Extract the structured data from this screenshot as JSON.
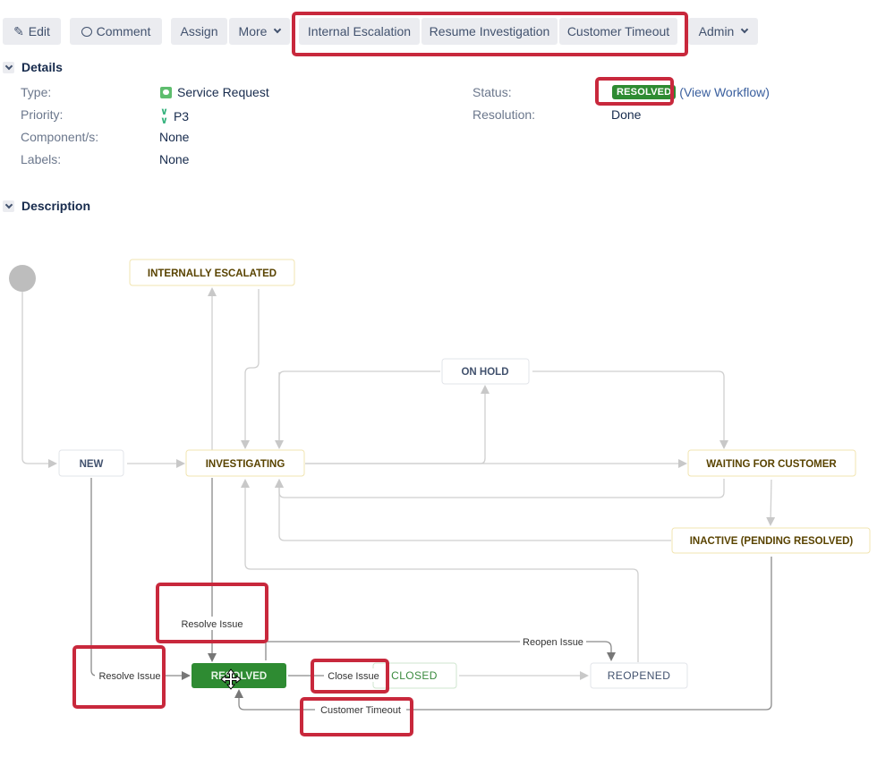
{
  "toolbar": {
    "edit": "Edit",
    "comment": "Comment",
    "assign": "Assign",
    "more": "More",
    "transitions": [
      "Internal Escalation",
      "Resume Investigation",
      "Customer Timeout"
    ],
    "admin": "Admin"
  },
  "details": {
    "heading": "Details",
    "type_label": "Type:",
    "type_value": "Service Request",
    "priority_label": "Priority:",
    "priority_value": "P3",
    "components_label": "Component/s:",
    "components_value": "None",
    "labels_label": "Labels:",
    "labels_value": "None",
    "status_label": "Status:",
    "status_value": "RESOLVED",
    "view_workflow": "(View Workflow)",
    "resolution_label": "Resolution:",
    "resolution_value": "Done"
  },
  "description": {
    "heading": "Description"
  },
  "workflow": {
    "nodes": {
      "internally_escalated": "INTERNALLY ESCALATED",
      "on_hold": "ON HOLD",
      "new": "NEW",
      "investigating": "INVESTIGATING",
      "waiting_for_customer": "WAITING FOR CUSTOMER",
      "inactive": "INACTIVE (PENDING RESOLVED)",
      "resolved": "RESOLVED",
      "closed": "CLOSED",
      "reopened": "REOPENED"
    },
    "edge_labels": {
      "resolve_issue_top": "Resolve Issue",
      "resolve_issue_left": "Resolve Issue",
      "close_issue": "Close Issue",
      "reopen_issue": "Reopen Issue",
      "customer_timeout": "Customer Timeout"
    }
  },
  "colors": {
    "resolved_green": "#2e8b32",
    "highlight_red": "#c8283c",
    "link_blue": "#3a5f9e"
  }
}
